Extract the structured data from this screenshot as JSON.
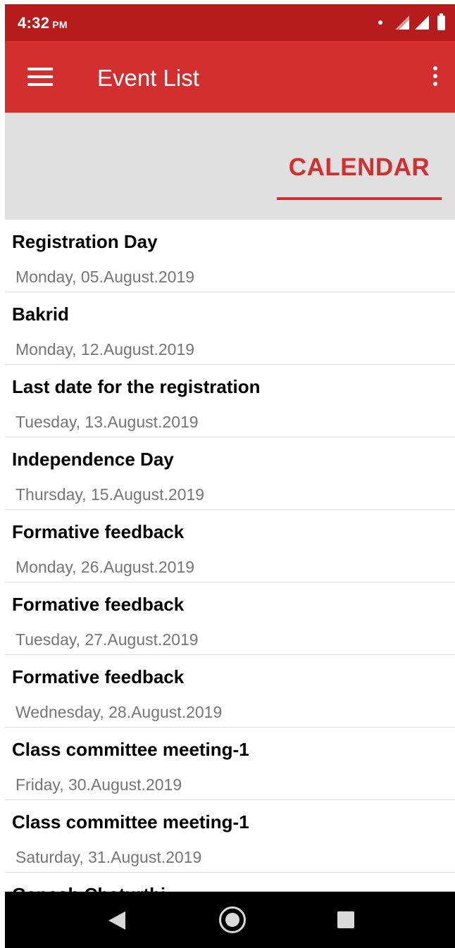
{
  "status_bar": {
    "time": "4:32",
    "ampm": "PM"
  },
  "app_bar": {
    "title": "Event List",
    "menu_icon": "hamburger-menu-icon",
    "overflow_icon": "more-vert-icon"
  },
  "tabs": {
    "calendar_label": "CALENDAR"
  },
  "events": [
    {
      "title": "Registration Day",
      "date": "Monday, 05.August.2019"
    },
    {
      "title": "Bakrid",
      "date": "Monday, 12.August.2019"
    },
    {
      "title": "Last date for the registration",
      "date": "Tuesday, 13.August.2019"
    },
    {
      "title": "Independence Day",
      "date": "Thursday, 15.August.2019"
    },
    {
      "title": "Formative feedback",
      "date": "Monday, 26.August.2019"
    },
    {
      "title": "Formative feedback",
      "date": "Tuesday, 27.August.2019"
    },
    {
      "title": "Formative feedback",
      "date": "Wednesday, 28.August.2019"
    },
    {
      "title": "Class committee meeting-1",
      "date": "Friday, 30.August.2019"
    },
    {
      "title": "Class committee meeting-1",
      "date": "Saturday, 31.August.2019"
    },
    {
      "title": "Ganesh Chaturthi",
      "date": ""
    }
  ],
  "colors": {
    "status_bar": "#b71c1c",
    "app_bar": "#d32f2f",
    "accent": "#d32f2f",
    "tab_background": "#e0e0e0",
    "date_text": "#757575"
  },
  "nav_bar": {
    "back_icon": "back-triangle-icon",
    "home_icon": "home-circle-icon",
    "recents_icon": "recents-square-icon"
  }
}
